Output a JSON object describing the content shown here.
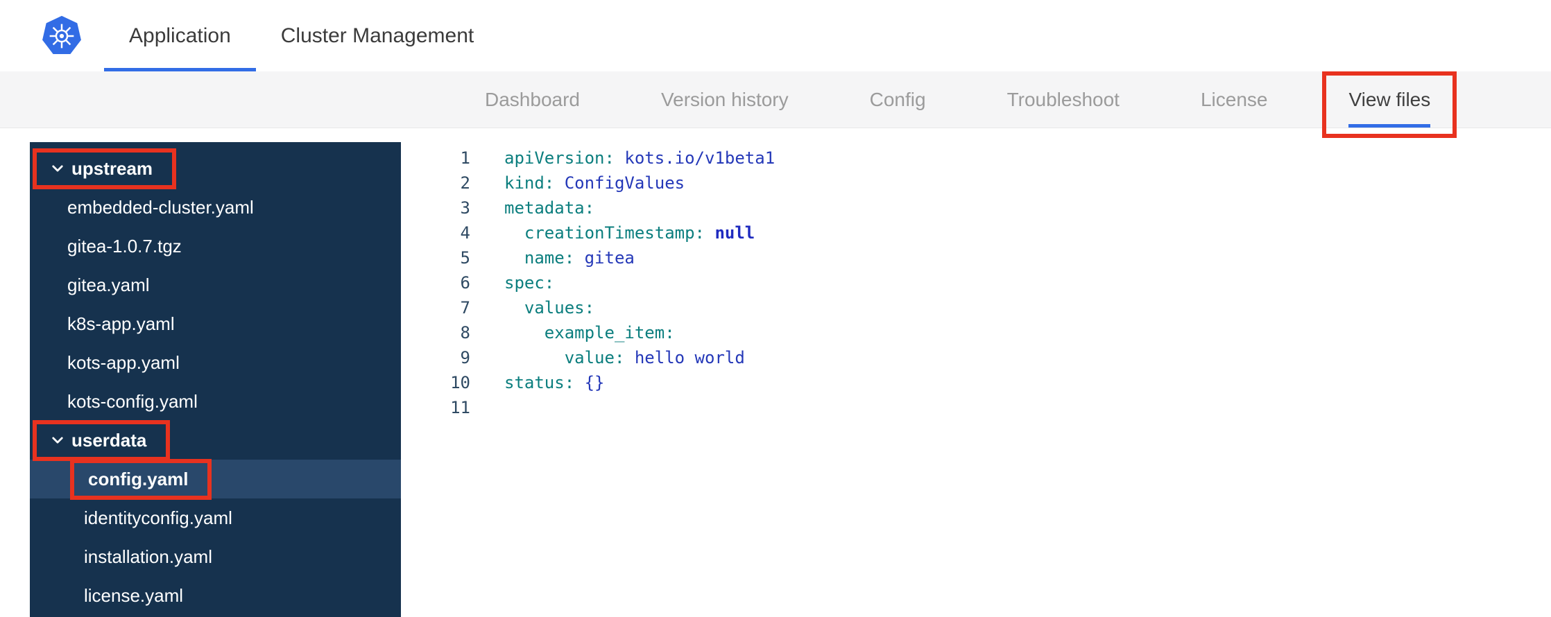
{
  "colors": {
    "accent_blue": "#326de6",
    "annotation_red": "#e8321f",
    "sidebar_bg": "#16324e",
    "sidebar_selected_bg": "#29486b",
    "code_key": "#0b7e7e",
    "code_value": "#2438b8",
    "gutter_number": "#2f4a63"
  },
  "header": {
    "logo_icon": "kubernetes-logo",
    "tabs": [
      {
        "label": "Application",
        "active": true
      },
      {
        "label": "Cluster Management",
        "active": false
      }
    ]
  },
  "nav": {
    "tabs": [
      {
        "label": "Dashboard",
        "active": false,
        "annotated": false
      },
      {
        "label": "Version history",
        "active": false,
        "annotated": false
      },
      {
        "label": "Config",
        "active": false,
        "annotated": false
      },
      {
        "label": "Troubleshoot",
        "active": false,
        "annotated": false
      },
      {
        "label": "License",
        "active": false,
        "annotated": false
      },
      {
        "label": "View files",
        "active": true,
        "annotated": true
      }
    ]
  },
  "file_tree": {
    "items": [
      {
        "label": "upstream",
        "type": "folder",
        "depth": 0,
        "expanded": true,
        "annotated": true,
        "selected": false
      },
      {
        "label": "embedded-cluster.yaml",
        "type": "file",
        "depth": 1,
        "annotated": false,
        "selected": false
      },
      {
        "label": "gitea-1.0.7.tgz",
        "type": "file",
        "depth": 1,
        "annotated": false,
        "selected": false
      },
      {
        "label": "gitea.yaml",
        "type": "file",
        "depth": 1,
        "annotated": false,
        "selected": false
      },
      {
        "label": "k8s-app.yaml",
        "type": "file",
        "depth": 1,
        "annotated": false,
        "selected": false
      },
      {
        "label": "kots-app.yaml",
        "type": "file",
        "depth": 1,
        "annotated": false,
        "selected": false
      },
      {
        "label": "kots-config.yaml",
        "type": "file",
        "depth": 1,
        "annotated": false,
        "selected": false
      },
      {
        "label": "userdata",
        "type": "folder",
        "depth": 1,
        "expanded": true,
        "annotated": true,
        "selected": false
      },
      {
        "label": "config.yaml",
        "type": "file",
        "depth": 2,
        "annotated": true,
        "selected": true
      },
      {
        "label": "identityconfig.yaml",
        "type": "file",
        "depth": 2,
        "annotated": false,
        "selected": false
      },
      {
        "label": "installation.yaml",
        "type": "file",
        "depth": 2,
        "annotated": false,
        "selected": false
      },
      {
        "label": "license.yaml",
        "type": "file",
        "depth": 2,
        "annotated": false,
        "selected": false
      }
    ]
  },
  "editor": {
    "lines": [
      {
        "number": "1",
        "tokens": [
          [
            "apiVersion:",
            "key"
          ],
          [
            " ",
            "plain"
          ],
          [
            "kots.io/v1beta1",
            "str"
          ]
        ]
      },
      {
        "number": "2",
        "tokens": [
          [
            "kind:",
            "key"
          ],
          [
            " ",
            "plain"
          ],
          [
            "ConfigValues",
            "str"
          ]
        ]
      },
      {
        "number": "3",
        "tokens": [
          [
            "metadata:",
            "key"
          ]
        ]
      },
      {
        "number": "4",
        "tokens": [
          [
            "  ",
            "plain"
          ],
          [
            "creationTimestamp:",
            "key"
          ],
          [
            " ",
            "plain"
          ],
          [
            "null",
            "const"
          ]
        ]
      },
      {
        "number": "5",
        "tokens": [
          [
            "  ",
            "plain"
          ],
          [
            "name:",
            "key"
          ],
          [
            " ",
            "plain"
          ],
          [
            "gitea",
            "str"
          ]
        ]
      },
      {
        "number": "6",
        "tokens": [
          [
            "spec:",
            "key"
          ]
        ]
      },
      {
        "number": "7",
        "tokens": [
          [
            "  ",
            "plain"
          ],
          [
            "values:",
            "key"
          ]
        ]
      },
      {
        "number": "8",
        "tokens": [
          [
            "    ",
            "plain"
          ],
          [
            "example_item:",
            "key"
          ]
        ]
      },
      {
        "number": "9",
        "tokens": [
          [
            "      ",
            "plain"
          ],
          [
            "value:",
            "key"
          ],
          [
            " ",
            "plain"
          ],
          [
            "hello world",
            "str"
          ]
        ]
      },
      {
        "number": "10",
        "tokens": [
          [
            "status:",
            "key"
          ],
          [
            " ",
            "plain"
          ],
          [
            "{}",
            "punct"
          ]
        ]
      },
      {
        "number": "11",
        "tokens": []
      }
    ]
  }
}
